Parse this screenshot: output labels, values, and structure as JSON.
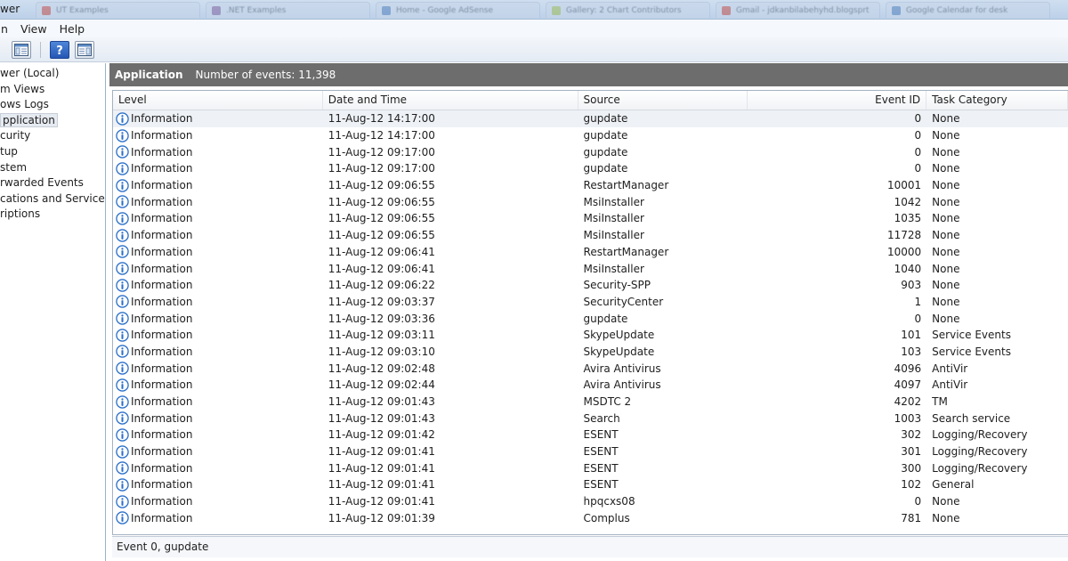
{
  "window": {
    "title_fragment": "wer"
  },
  "tabs": [
    {
      "label": "UT Examples",
      "color": "#c0504d"
    },
    {
      "label": ".NET Examples",
      "color": "#8064a2"
    },
    {
      "label": "Home - Google AdSense",
      "color": "#4f81bd"
    },
    {
      "label": "Gallery: 2 Chart Contributors",
      "color": "#9bbb59"
    },
    {
      "label": "Gmail - jdkanbilabehyhd.blogsprt",
      "color": "#c0504d"
    },
    {
      "label": "Google Calendar for desk",
      "color": "#4f81bd"
    }
  ],
  "menu": [
    "n",
    "View",
    "Help"
  ],
  "toolbar": {
    "buttons": [
      "console-tree-icon",
      "help-icon",
      "action-pane-icon"
    ]
  },
  "tree": {
    "items": [
      "wer (Local)",
      "m Views",
      "ows Logs",
      "pplication",
      "curity",
      "tup",
      "stem",
      "rwarded Events",
      "cations and Services Lo",
      "riptions"
    ],
    "selected_index": 3
  },
  "log": {
    "name": "Application",
    "event_count": "Number of events: 11,398"
  },
  "columns": [
    "Level",
    "Date and Time",
    "Source",
    "Event ID",
    "Task Category"
  ],
  "events": [
    {
      "level": "Information",
      "date": "11-Aug-12 14:17:00",
      "source": "gupdate",
      "id": "0",
      "task": "None"
    },
    {
      "level": "Information",
      "date": "11-Aug-12 14:17:00",
      "source": "gupdate",
      "id": "0",
      "task": "None"
    },
    {
      "level": "Information",
      "date": "11-Aug-12 09:17:00",
      "source": "gupdate",
      "id": "0",
      "task": "None"
    },
    {
      "level": "Information",
      "date": "11-Aug-12 09:17:00",
      "source": "gupdate",
      "id": "0",
      "task": "None"
    },
    {
      "level": "Information",
      "date": "11-Aug-12 09:06:55",
      "source": "RestartManager",
      "id": "10001",
      "task": "None"
    },
    {
      "level": "Information",
      "date": "11-Aug-12 09:06:55",
      "source": "MsiInstaller",
      "id": "1042",
      "task": "None"
    },
    {
      "level": "Information",
      "date": "11-Aug-12 09:06:55",
      "source": "MsiInstaller",
      "id": "1035",
      "task": "None"
    },
    {
      "level": "Information",
      "date": "11-Aug-12 09:06:55",
      "source": "MsiInstaller",
      "id": "11728",
      "task": "None"
    },
    {
      "level": "Information",
      "date": "11-Aug-12 09:06:41",
      "source": "RestartManager",
      "id": "10000",
      "task": "None"
    },
    {
      "level": "Information",
      "date": "11-Aug-12 09:06:41",
      "source": "MsiInstaller",
      "id": "1040",
      "task": "None"
    },
    {
      "level": "Information",
      "date": "11-Aug-12 09:06:22",
      "source": "Security-SPP",
      "id": "903",
      "task": "None"
    },
    {
      "level": "Information",
      "date": "11-Aug-12 09:03:37",
      "source": "SecurityCenter",
      "id": "1",
      "task": "None"
    },
    {
      "level": "Information",
      "date": "11-Aug-12 09:03:36",
      "source": "gupdate",
      "id": "0",
      "task": "None"
    },
    {
      "level": "Information",
      "date": "11-Aug-12 09:03:11",
      "source": "SkypeUpdate",
      "id": "101",
      "task": "Service Events"
    },
    {
      "level": "Information",
      "date": "11-Aug-12 09:03:10",
      "source": "SkypeUpdate",
      "id": "103",
      "task": "Service Events"
    },
    {
      "level": "Information",
      "date": "11-Aug-12 09:02:48",
      "source": "Avira Antivirus",
      "id": "4096",
      "task": "AntiVir"
    },
    {
      "level": "Information",
      "date": "11-Aug-12 09:02:44",
      "source": "Avira Antivirus",
      "id": "4097",
      "task": "AntiVir"
    },
    {
      "level": "Information",
      "date": "11-Aug-12 09:01:43",
      "source": "MSDTC 2",
      "id": "4202",
      "task": "TM"
    },
    {
      "level": "Information",
      "date": "11-Aug-12 09:01:43",
      "source": "Search",
      "id": "1003",
      "task": "Search service"
    },
    {
      "level": "Information",
      "date": "11-Aug-12 09:01:42",
      "source": "ESENT",
      "id": "302",
      "task": "Logging/Recovery"
    },
    {
      "level": "Information",
      "date": "11-Aug-12 09:01:41",
      "source": "ESENT",
      "id": "301",
      "task": "Logging/Recovery"
    },
    {
      "level": "Information",
      "date": "11-Aug-12 09:01:41",
      "source": "ESENT",
      "id": "300",
      "task": "Logging/Recovery"
    },
    {
      "level": "Information",
      "date": "11-Aug-12 09:01:41",
      "source": "ESENT",
      "id": "102",
      "task": "General"
    },
    {
      "level": "Information",
      "date": "11-Aug-12 09:01:41",
      "source": "hpqcxs08",
      "id": "0",
      "task": "None"
    },
    {
      "level": "Information",
      "date": "11-Aug-12 09:01:39",
      "source": "Complus",
      "id": "781",
      "task": "None"
    }
  ],
  "preview": {
    "title": "Event 0, gupdate"
  },
  "colors": {
    "header_bar": "#6d6d6d",
    "info_icon": "#2a6fc9",
    "selection": "#eef1f5"
  }
}
